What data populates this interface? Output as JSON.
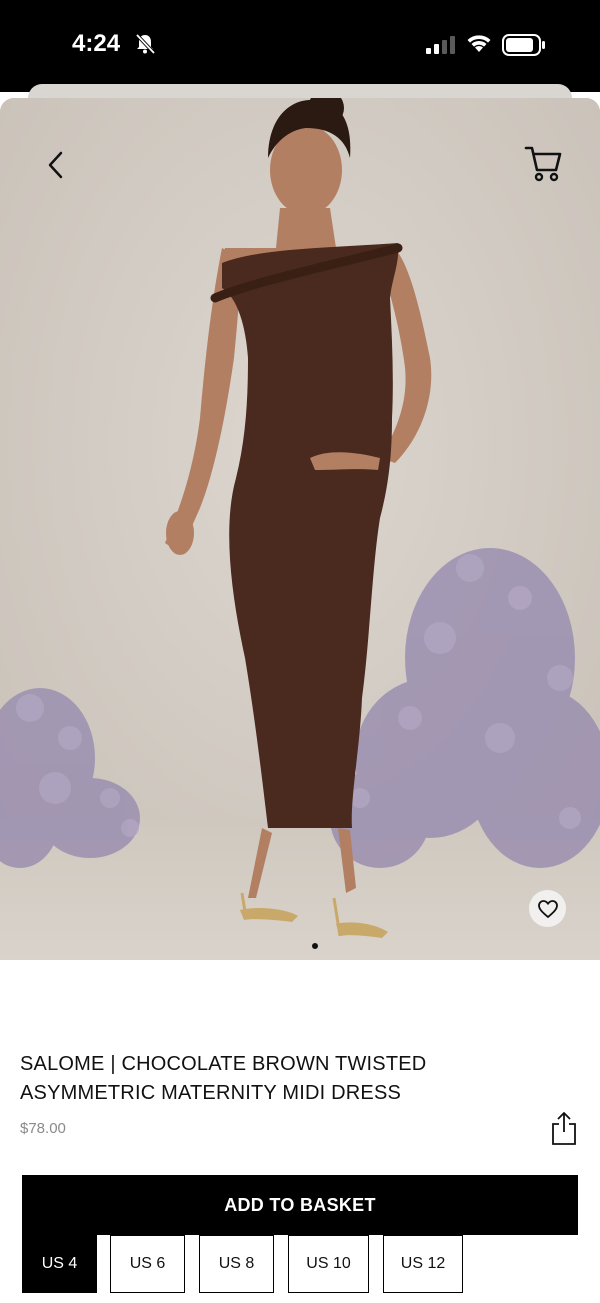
{
  "status_bar": {
    "time": "4:24",
    "icons": [
      "bell-slash-icon",
      "signal-icon",
      "wifi-icon",
      "battery-icon"
    ]
  },
  "hero": {
    "image_description": "photo of model in chocolate brown twisted asymmetric maternity midi dress",
    "carousel_page": 1,
    "icons": [
      "chevron-left-icon",
      "cart-icon",
      "heart-icon"
    ]
  },
  "product": {
    "title": "SALOME | CHOCOLATE BROWN TWISTED ASYMMETRIC MATERNITY MIDI DRESS",
    "price": "$78.00",
    "share_icon": "share-icon"
  },
  "actions": {
    "add_to_basket": "ADD TO BASKET"
  },
  "sizes": {
    "selected": "US 4",
    "options": [
      "US 4",
      "US 6",
      "US 8",
      "US 10",
      "US 12"
    ]
  },
  "colors": {
    "accent": "#000000",
    "background": "#ffffff",
    "dress": "#4a2a1e",
    "hero_backdrop": "#d3cdc6",
    "price_text": "#8a8a8a"
  }
}
